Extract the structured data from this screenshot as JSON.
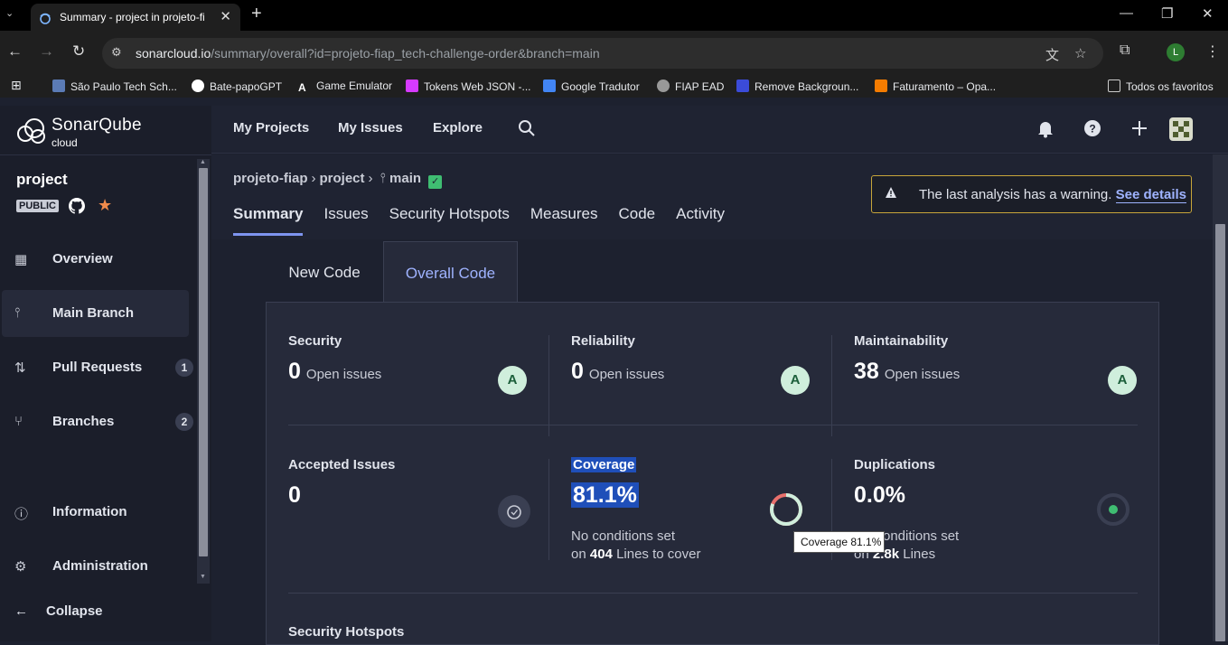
{
  "browser": {
    "tab_title": "Summary - project in projeto-fi",
    "url_host": "sonarcloud.io",
    "url_path": "/summary/overall?id=projeto-fiap_tech-challenge-order&branch=main",
    "profile_initial": "L",
    "bookmarks": [
      "São Paulo Tech Sch...",
      "Bate-papoGPT",
      "Game Emulator",
      "Tokens Web JSON -...",
      "Google Tradutor",
      "FIAP EAD",
      "Remove Backgroun...",
      "Faturamento – Opa..."
    ],
    "all_bookmarks": "Todos os favoritos"
  },
  "sidebar": {
    "brand_line1": "SonarQube",
    "brand_line2": "cloud",
    "project_name": "project",
    "visibility_badge": "PUBLIC",
    "nav": [
      {
        "label": "Overview",
        "icon": "grid-icon"
      },
      {
        "label": "Main Branch",
        "icon": "branch-icon"
      },
      {
        "label": "Pull Requests",
        "icon": "pull-request-icon",
        "count": "1"
      },
      {
        "label": "Branches",
        "icon": "branches-icon",
        "count": "2"
      },
      {
        "label": "Information",
        "icon": "info-icon"
      },
      {
        "label": "Administration",
        "icon": "gear-icon"
      }
    ],
    "collapse_label": "Collapse"
  },
  "topnav": {
    "links": [
      "My Projects",
      "My Issues",
      "Explore"
    ]
  },
  "project_header": {
    "breadcrumb_org": "projeto-fiap",
    "breadcrumb_project": "project",
    "breadcrumb_branch": "main",
    "tabs": [
      "Summary",
      "Issues",
      "Security Hotspots",
      "Measures",
      "Code",
      "Activity"
    ],
    "active_tab": "Summary",
    "warning_text": "The last analysis has a warning.",
    "warning_link": "See details"
  },
  "code_tabs": {
    "new_code": "New Code",
    "overall_code": "Overall Code"
  },
  "metrics": {
    "security": {
      "title": "Security",
      "value": "0",
      "unit": "Open issues",
      "grade": "A"
    },
    "reliability": {
      "title": "Reliability",
      "value": "0",
      "unit": "Open issues",
      "grade": "A"
    },
    "maintainability": {
      "title": "Maintainability",
      "value": "38",
      "unit": "Open issues",
      "grade": "A"
    },
    "accepted": {
      "title": "Accepted Issues",
      "value": "0"
    },
    "coverage": {
      "title": "Coverage",
      "value": "81.1%",
      "percent": 81.1,
      "line1": "No conditions set",
      "line2_prefix": "on",
      "line2_value": "404",
      "line2_suffix": "Lines to cover"
    },
    "duplications": {
      "title": "Duplications",
      "value": "0.0%",
      "line1": "onditions set",
      "line2_prefix": "on",
      "line2_value": "2.8k",
      "line2_suffix": "Lines"
    },
    "security_hotspots": {
      "title": "Security Hotspots"
    }
  },
  "tooltip": "Coverage 81.1%",
  "colors": {
    "accent": "#7e95f0",
    "grade_a_bg": "#cfeedc",
    "warning_border": "#c7a53a",
    "coverage_good": "#cfeedc",
    "coverage_bad": "#e8706c",
    "duplication_dot": "#3fbd72"
  }
}
